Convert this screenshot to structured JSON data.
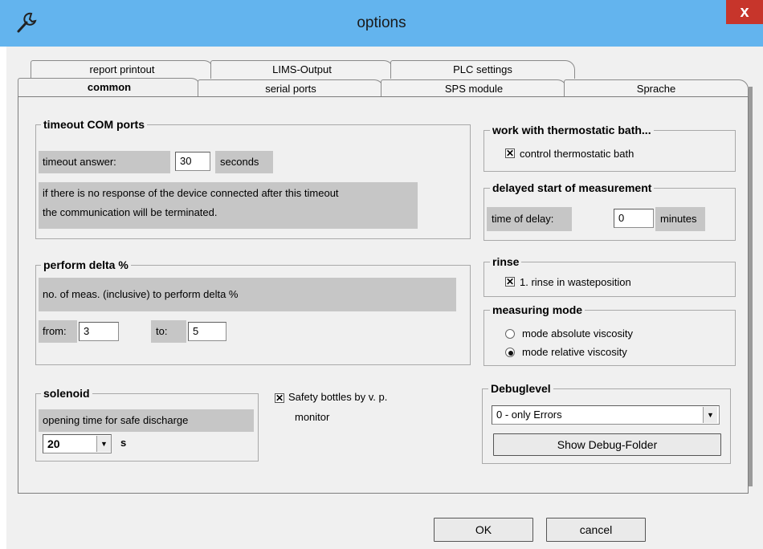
{
  "window": {
    "title": "options",
    "close_label": "x"
  },
  "tabs_back": [
    "report printout",
    "LIMS-Output",
    "PLC settings"
  ],
  "tabs_front": [
    "common",
    "serial ports",
    "SPS module",
    "Sprache"
  ],
  "timeout": {
    "title": "timeout COM ports",
    "answer_label": "timeout answer:",
    "answer_value": "30",
    "answer_unit": "seconds",
    "note_line1": "if there is no response of the device connected after this timeout",
    "note_line2": "the communication will be terminated."
  },
  "delta": {
    "title": "perform delta %",
    "desc": "no. of meas. (inclusive) to perform delta %",
    "from_label": "from:",
    "from_value": "3",
    "to_label": "to:",
    "to_value": "5"
  },
  "solenoid": {
    "title": "solenoid",
    "opening_label": "opening time for safe discharge",
    "value": "20",
    "unit": "s"
  },
  "safety": {
    "label_line1": "Safety bottles by v. p.",
    "label_line2": "monitor",
    "checked": true
  },
  "thermo": {
    "title": "work with thermostatic bath...",
    "checkbox_label": "control thermostatic bath",
    "checked": true
  },
  "delayed": {
    "title": "delayed start of measurement",
    "label": "time of delay:",
    "value": "0",
    "unit": "minutes"
  },
  "rinse": {
    "title": "rinse",
    "checkbox_label": "1. rinse in wasteposition",
    "checked": true
  },
  "mode": {
    "title": "measuring mode",
    "options": [
      "mode absolute viscosity",
      "mode relative viscosity"
    ],
    "selected_index": 1
  },
  "debug": {
    "title": "Debuglevel",
    "selected": "0 - only Errors",
    "folder_button": "Show Debug-Folder"
  },
  "footer": {
    "ok": "OK",
    "cancel": "cancel"
  }
}
